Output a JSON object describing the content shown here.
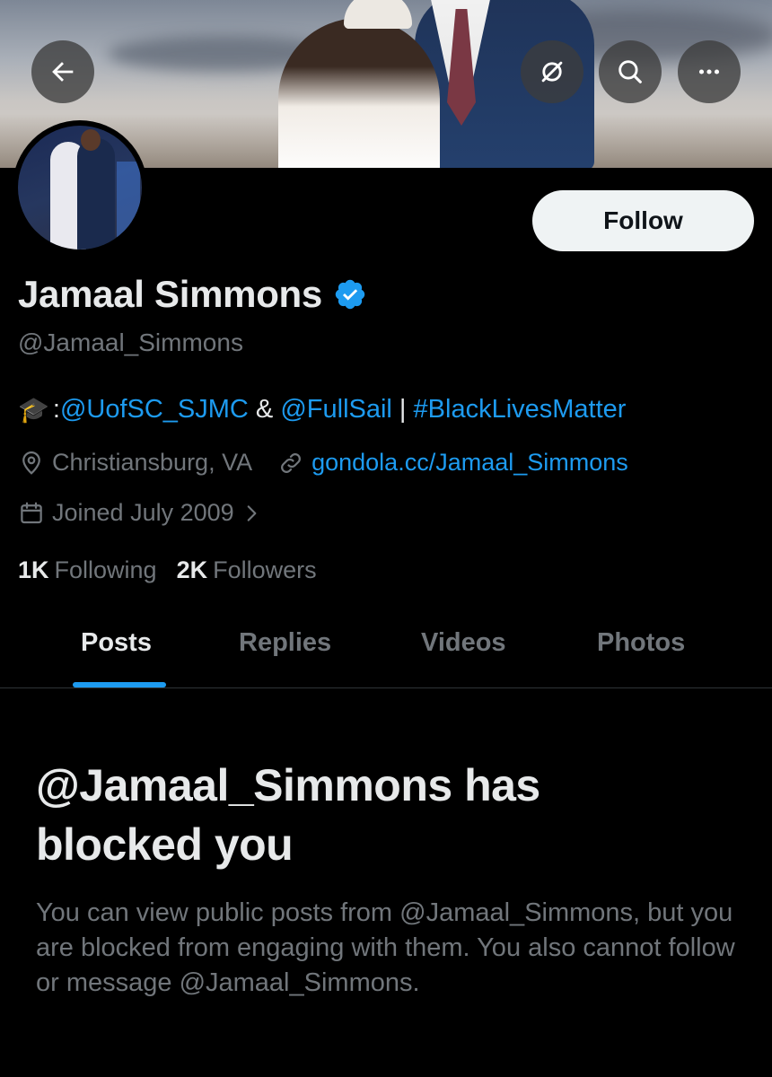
{
  "header": {
    "buttons": {
      "back": "back-arrow-icon",
      "grok": "slash-circle-icon",
      "search": "search-icon",
      "more": "more-icon"
    }
  },
  "profile": {
    "name": "Jamaal Simmons",
    "handle": "@Jamaal_Simmons",
    "verified": true,
    "follow_label": "Follow",
    "bio": {
      "emoji": "🎓",
      "colon": ": ",
      "mention1": "@UofSC_SJMC",
      "amp": " & ",
      "mention2": "@FullSail",
      "sep": " | ",
      "hashtag": "#BlackLivesMatter"
    },
    "location": "Christiansburg, VA",
    "website": "gondola.cc/Jamaal_Simmons",
    "joined": "Joined July 2009",
    "following_count": "1K",
    "following_label": "Following",
    "followers_count": "2K",
    "followers_label": "Followers"
  },
  "tabs": [
    {
      "label": "Posts",
      "active": true
    },
    {
      "label": "Replies",
      "active": false
    },
    {
      "label": "Videos",
      "active": false
    },
    {
      "label": "Photos",
      "active": false
    }
  ],
  "blocked": {
    "title": "@Jamaal_Simmons has blocked you",
    "description": "You can view public posts from @Jamaal_Simmons, but you are blocked from engaging with them. You also cannot follow or message @Jamaal_Simmons."
  },
  "colors": {
    "accent": "#1d9bf0",
    "background": "#000000",
    "text": "#e7e9ea",
    "secondary": "#71767b"
  }
}
